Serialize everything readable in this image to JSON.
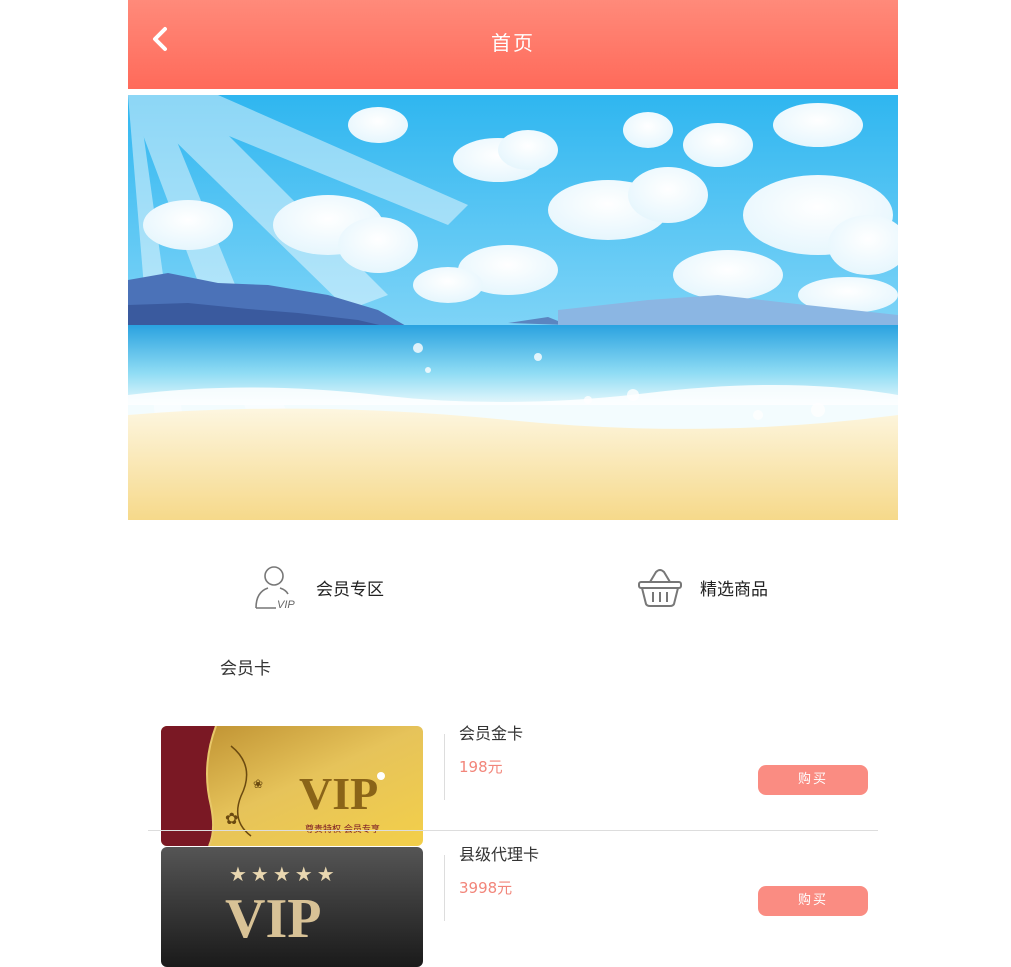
{
  "header": {
    "title": "首页",
    "back_icon": "chevron-left-icon"
  },
  "colors": {
    "header": "#ff7565",
    "accent": "#fa8c82",
    "price": "#f2857a"
  },
  "shortcuts": [
    {
      "label": "会员专区",
      "icon": "user-vip-icon"
    },
    {
      "label": "精选商品",
      "icon": "basket-icon"
    }
  ],
  "section": {
    "title": "会员卡"
  },
  "products": [
    {
      "name": "会员金卡",
      "price": "198元",
      "buy_label": "购买",
      "thumb": "gold-vip-card-image"
    },
    {
      "name": "县级代理卡",
      "price": "3998元",
      "buy_label": "购买",
      "thumb": "black-vip-card-image"
    }
  ],
  "thumbs": {
    "gold_text": "VIP",
    "gold_sub": "尊贵特权 会员专享",
    "black_text": "VIP",
    "black_stars": "★★★★★"
  }
}
